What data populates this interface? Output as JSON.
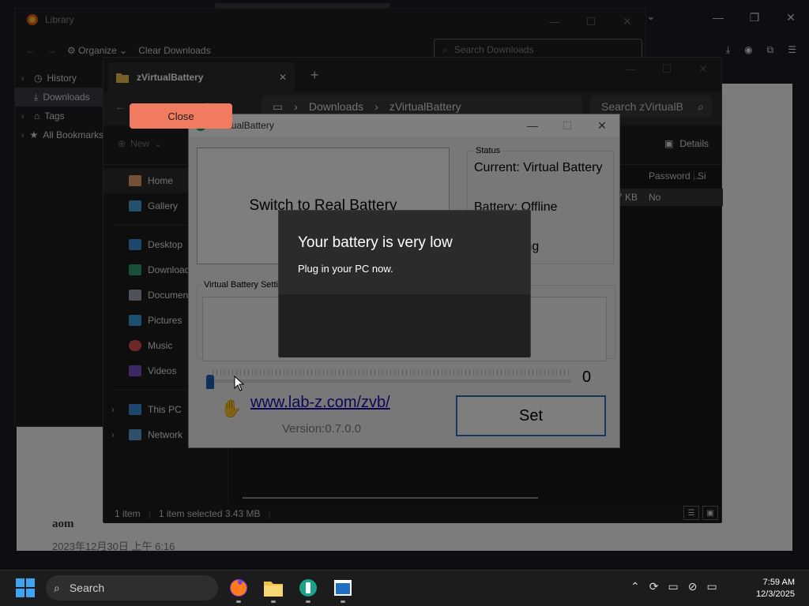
{
  "firefox": {
    "blog_author": "aom",
    "blog_date": "2023年12月30日 上午 6:16"
  },
  "library": {
    "title": "Library",
    "toolbar": {
      "organize": "Organize",
      "clear": "Clear Downloads"
    },
    "search_placeholder": "Search Downloads",
    "tree": [
      {
        "label": "History"
      },
      {
        "label": "Downloads"
      },
      {
        "label": "Tags"
      },
      {
        "label": "All Bookmarks"
      }
    ]
  },
  "explorer": {
    "tab_title": "zVirtualBattery",
    "address": {
      "crumb1": "Downloads",
      "crumb2": "zVirtualBattery"
    },
    "search_placeholder": "Search zVirtualB",
    "new_label": "New",
    "details_label": "Details",
    "nav": {
      "home": "Home",
      "gallery": "Gallery",
      "desktop": "Desktop",
      "downloads": "Downloads",
      "documents": "Documents",
      "pictures": "Pictures",
      "music": "Music",
      "videos": "Videos",
      "this_pc": "This PC",
      "network": "Network"
    },
    "columns": {
      "password": "Password ...",
      "size": "Si"
    },
    "row": {
      "size": "7 KB",
      "password": "No"
    },
    "status": {
      "count": "1 item",
      "selected": "1 item selected  3.43 MB"
    }
  },
  "zvb": {
    "title": "zVirtualBattery",
    "switch_label": "Switch to Real Battery",
    "status_label": "Status",
    "status_current": "Current: Virtual Battery",
    "status_battery": "Battery: Offline",
    "status_remaining": "ning",
    "settings_label": "Virtual Battery Setting",
    "slider_value": "0",
    "slider_fraction": 0,
    "link": "www.lab-z.com/zvb/",
    "version": "Version:0.7.0.0",
    "set_label": "Set"
  },
  "toast": {
    "title": "Your battery is very low",
    "message": "Plug in your PC now.",
    "close": "Close"
  },
  "taskbar": {
    "search": "Search",
    "time": "7:59 AM",
    "date": "12/3/2025"
  }
}
